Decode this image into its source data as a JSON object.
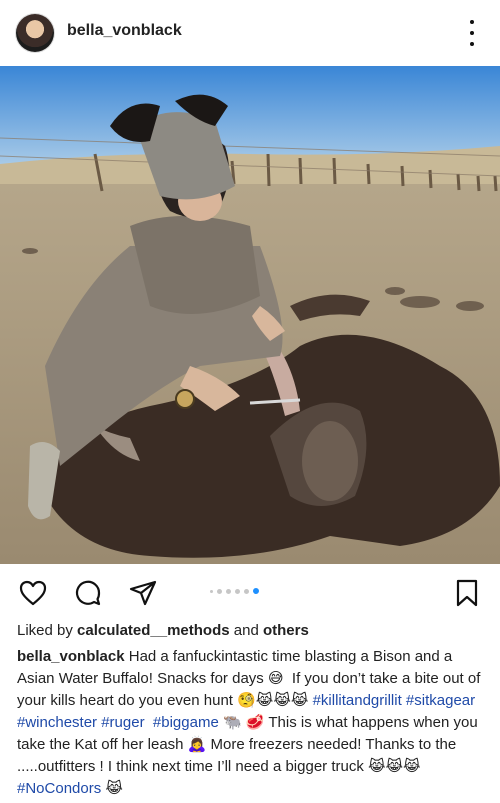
{
  "post": {
    "username": "bella_vonblack",
    "image_alt": "",
    "carousel": {
      "count": 6,
      "active_index": 5
    },
    "likes": {
      "prefix": "Liked by ",
      "user": "calculated__methods",
      "middle": " and ",
      "others": "others"
    },
    "caption": {
      "username": "bella_vonblack",
      "part1": " Had a fanfuckintastic time blasting a Bison and a Asian Water Buffalo! Snacks for days 😅  If you don’t take a bite out of your kills heart do you even hunt 🧐😹😹😹 ",
      "tags1": "#killitandgrillit #sitkagear #winchester #ruger  #biggame",
      "part2": " 🐃 🥩 This is what happens when you take the Kat off her leash 🙇‍♀️ More freezers needed! Thanks to the .....outfitters ! I think next time I’ll need a bigger truck 😹😹😹 ",
      "tags2": "#NoCondors",
      "part3": " 😹"
    }
  },
  "icons": {
    "more": "more-vertical-icon",
    "like": "heart-icon",
    "comment": "comment-icon",
    "share": "share-icon",
    "save": "bookmark-icon"
  },
  "colors": {
    "text": "#222222",
    "hashtag": "#1f4aa8",
    "carousel_active": "#1e90ff",
    "carousel_inactive": "#c6c6c6"
  }
}
